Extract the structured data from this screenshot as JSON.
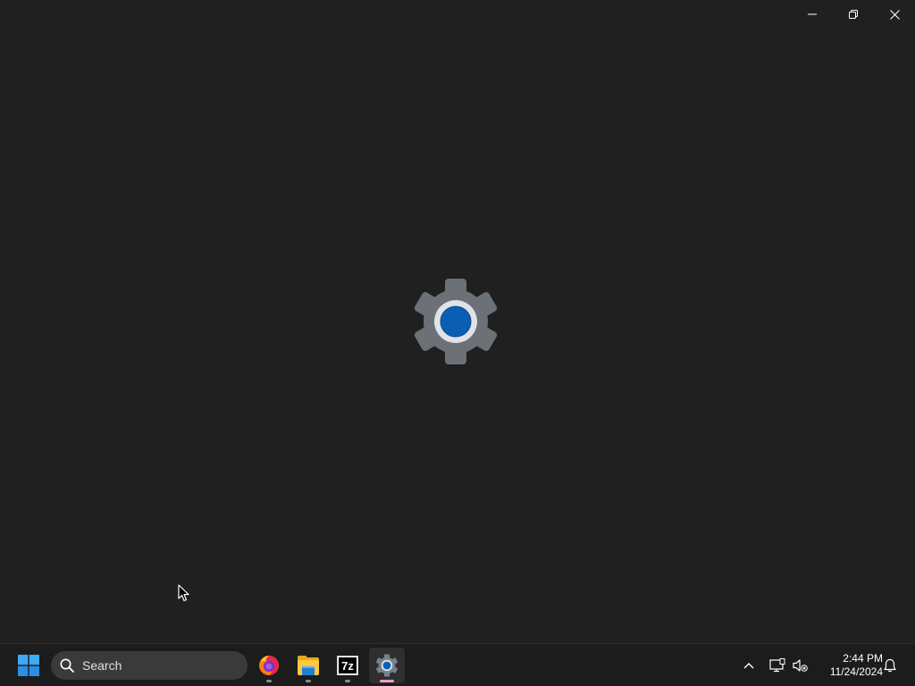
{
  "window": {
    "caption_buttons": [
      {
        "name": "minimize",
        "icon": "minimize-icon"
      },
      {
        "name": "maximize",
        "icon": "restore-icon"
      },
      {
        "name": "close",
        "icon": "close-icon"
      }
    ],
    "splash_icon": "settings-gear-icon"
  },
  "taskbar": {
    "start_icon": "windows-start-icon",
    "search": {
      "placeholder": "Search",
      "icon": "search-icon"
    },
    "apps": [
      {
        "name": "Firefox",
        "icon": "firefox-icon",
        "running": true,
        "active": false
      },
      {
        "name": "File Explorer",
        "icon": "file-explorer-icon",
        "running": true,
        "active": false
      },
      {
        "name": "7-Zip",
        "icon": "7zip-icon",
        "label": "7z",
        "running": true,
        "active": false
      },
      {
        "name": "Settings",
        "icon": "settings-gear-icon",
        "running": true,
        "active": true
      }
    ],
    "tray": {
      "icons": [
        "chevron-up-icon",
        "network-icon",
        "volume-muted-icon",
        "bell-icon"
      ],
      "time": "2:44 PM",
      "date": "11/24/2024"
    }
  },
  "colors": {
    "background": "#202020",
    "taskbar": "#1c1c1c",
    "search_box": "#3a3a3a",
    "gear_gray": "#6b7177",
    "gear_blue": "#0a5fb4",
    "active_indicator": "#e7a0c8"
  }
}
